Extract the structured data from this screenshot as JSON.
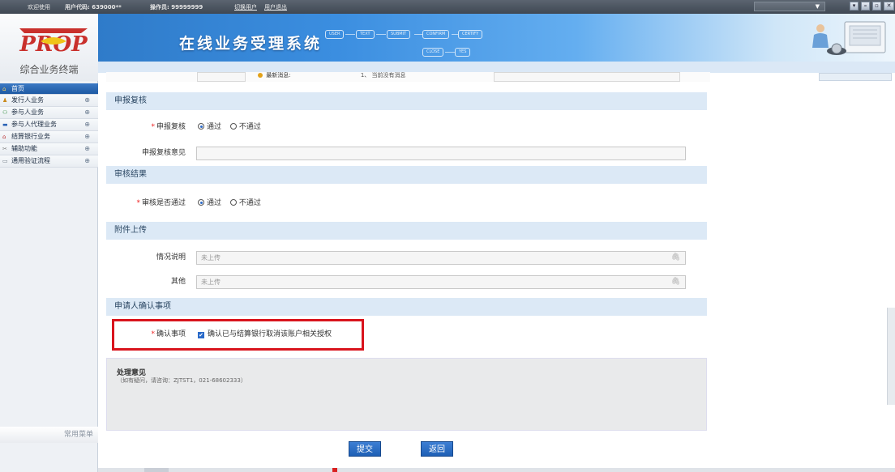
{
  "topbar": {
    "welcome": "欢迎使用",
    "user_code": "用户代码: 639000**",
    "operator": "操作员: 99999999",
    "switch_user": "切换用户",
    "logout": "用户退出",
    "select_arrow": "▼",
    "win_buttons": [
      "▾",
      "–",
      "▫",
      "✕"
    ]
  },
  "left": {
    "logo_text": "PROP",
    "subtitle": "综合业务终端",
    "menu": [
      {
        "label": "首页",
        "icon": "home-icon",
        "glyph": "⌂",
        "active": true
      },
      {
        "label": "发行人业务",
        "icon": "person-icon",
        "glyph": "♟",
        "plus": "⊕"
      },
      {
        "label": "参与人业务",
        "icon": "people-icon",
        "glyph": "⚇",
        "plus": "⊕"
      },
      {
        "label": "参与人代理业务",
        "icon": "monitor-icon",
        "glyph": "▬",
        "plus": "⊕"
      },
      {
        "label": "结算银行业务",
        "icon": "bank-icon",
        "glyph": "⌂",
        "plus": "⊕"
      },
      {
        "label": "辅助功能",
        "icon": "tools-icon",
        "glyph": "✂",
        "plus": "⊕"
      },
      {
        "label": "通用验证流程",
        "icon": "folder-icon",
        "glyph": "▭",
        "plus": "⊕"
      }
    ],
    "common_menu": "常用菜单"
  },
  "header": {
    "system_title": "在线业务受理系统",
    "flow_steps": [
      "USER",
      "TEXT",
      "SUBMIT",
      "CONFIRM",
      "CERTIFY",
      "CLOSE",
      "YES"
    ]
  },
  "news": {
    "label": "最新消息:",
    "item": "1、 当前没有消息"
  },
  "sections": {
    "review": "申报复核",
    "result": "审核结果",
    "attachments": "附件上传",
    "confirm": "申请人确认事项"
  },
  "form": {
    "required_mark": "*",
    "review_label": "申报复核",
    "review_opinion_label": "申报复核意见",
    "result_label": "审核是否通过",
    "pass": "通过",
    "fail": "不通过",
    "situation_label": "情况说明",
    "other_label": "其他",
    "not_uploaded": "未上传",
    "clip_glyph": "🖇",
    "confirm_label": "确认事项",
    "confirm_check_glyph": "✔",
    "confirm_text": "确认已与结算银行取消该账户相关授权"
  },
  "opinion": {
    "title": "处理意见",
    "hint": "（如有疑问，请咨询：ZJTST1，021-68602333）"
  },
  "buttons": {
    "submit": "提交",
    "back": "返回"
  },
  "colors": {
    "accent_blue": "#2a6ac9",
    "section_bg": "#dce9f6",
    "highlight_red": "#d9141d"
  }
}
